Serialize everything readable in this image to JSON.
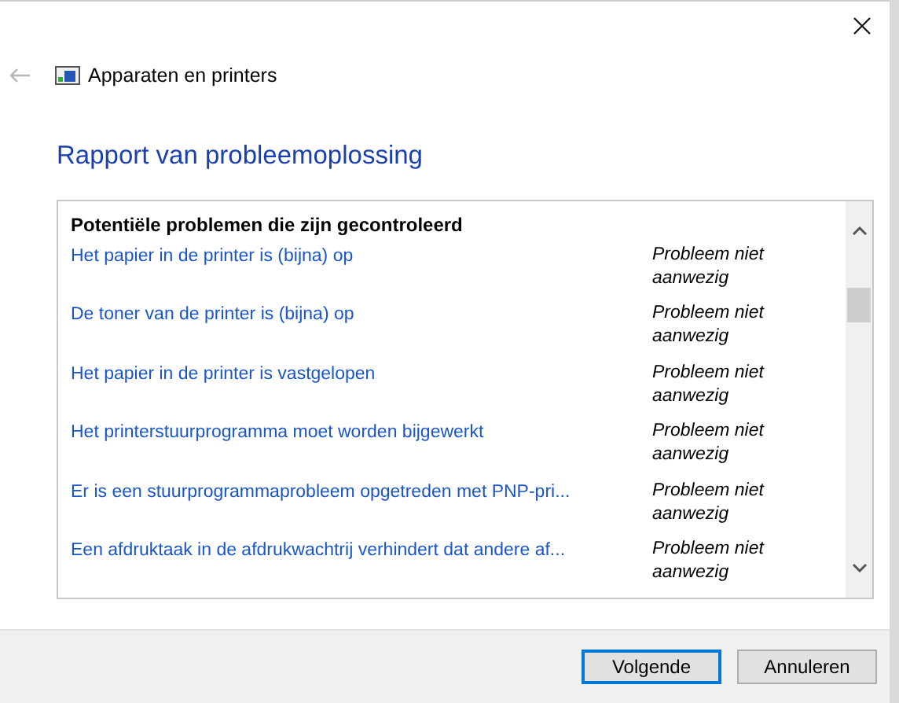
{
  "nav": {
    "title": "Apparaten en printers"
  },
  "heading": "Rapport van probleemoplossing",
  "list": {
    "header": "Potentiële problemen die zijn gecontroleerd",
    "rows": [
      {
        "problem": "Het papier in de printer is (bijna) op",
        "status": "Probleem niet aanwezig"
      },
      {
        "problem": "De toner van de printer is (bijna) op",
        "status": "Probleem niet aanwezig"
      },
      {
        "problem": "Het papier in de printer is vastgelopen",
        "status": "Probleem niet aanwezig"
      },
      {
        "problem": "Het printerstuurprogramma moet worden bijgewerkt",
        "status": "Probleem niet aanwezig"
      },
      {
        "problem": "Er is een stuurprogrammaprobleem opgetreden met PNP-pri...",
        "status": "Probleem niet aanwezig"
      },
      {
        "problem": "Een afdruktaak in de afdrukwachtrij verhindert dat andere af...",
        "status": "Probleem niet aanwezig"
      }
    ]
  },
  "buttons": [
    {
      "label": "Volgende",
      "selected": true
    },
    {
      "label": "Annuleren",
      "selected": false
    }
  ]
}
